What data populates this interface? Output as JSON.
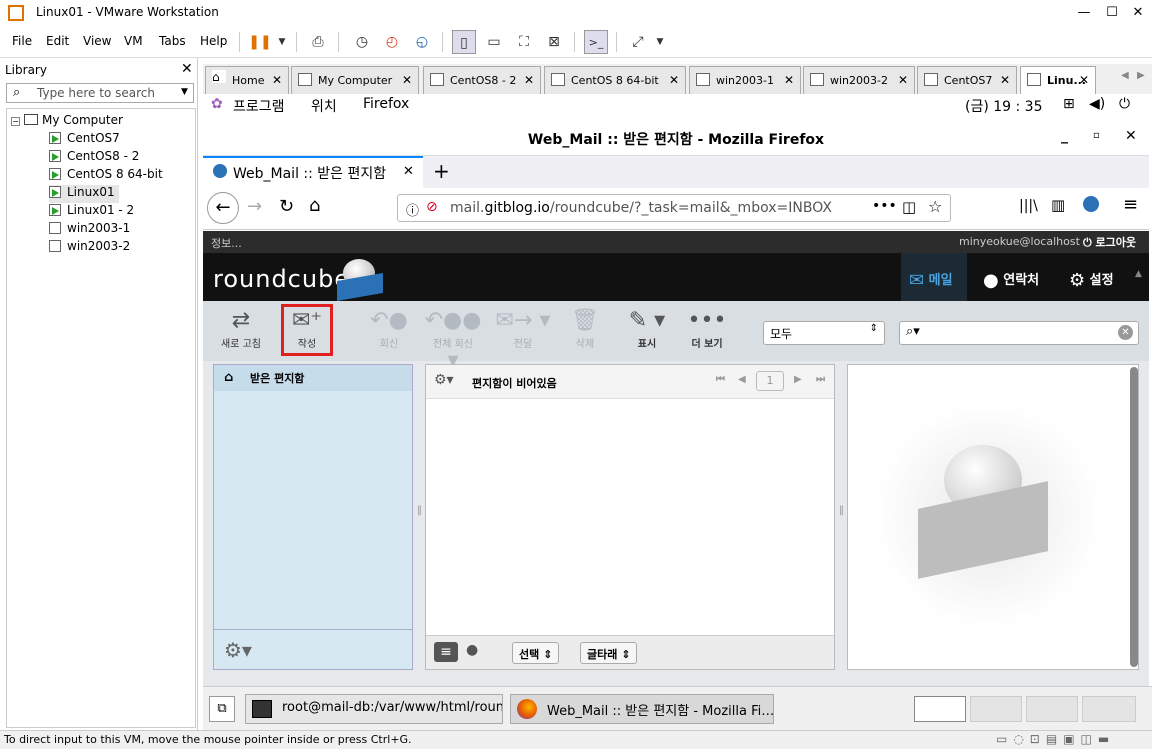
{
  "app": {
    "title": "Linux01 - VMware Workstation"
  },
  "menu": [
    "File",
    "Edit",
    "View",
    "VM",
    "Tabs",
    "Help"
  ],
  "library": {
    "header": "Library",
    "search_placeholder": "Type here to search",
    "root": "My Computer",
    "items": [
      "CentOS7",
      "CentOS8 - 2",
      "CentOS 8 64-bit",
      "Linux01",
      "Linux01 - 2",
      "win2003-1",
      "win2003-2"
    ]
  },
  "vm_tabs": [
    "Home",
    "My Computer",
    "CentOS8 - 2",
    "CentOS 8 64-bit",
    "win2003-1",
    "win2003-2",
    "CentOS7",
    "Linu..."
  ],
  "gnome": {
    "apps": "프로그램",
    "places": "위치",
    "firefox": "Firefox",
    "clock": "(금) 19 : 35"
  },
  "firefox": {
    "window_title": "Web_Mail :: 받은 편지함 - Mozilla Firefox",
    "tab_title": "Web_Mail :: 받은 편지함",
    "url_host": "mail.gitblog.io",
    "url_path": "/roundcube/?_task=mail&_mbox=INBOX",
    "url_prefix": "mail."
  },
  "roundcube": {
    "info": "정보...",
    "user": "minyeokue@localhost",
    "logout": "로그아웃",
    "logo": "roundcube",
    "nav": {
      "mail": "메일",
      "contacts": "연락처",
      "settings": "설정"
    },
    "toolbar": {
      "refresh": "새로 고침",
      "compose": "작성",
      "reply": "회신",
      "reply_all": "전체 회신",
      "forward": "전달",
      "delete": "삭제",
      "mark": "표시",
      "more": "더 보기"
    },
    "filter": "모두",
    "folder_inbox": "받은 편지함",
    "list_empty": "편지함이 비어있음",
    "page": "1",
    "select_btn": "선택",
    "thread_btn": "글타래"
  },
  "taskbar": {
    "terminal": "root@mail-db:/var/www/html/roun…",
    "firefox": "Web_Mail :: 받은 편지함 - Mozilla Fi…"
  },
  "status_text": "To direct input to this VM, move the mouse pointer inside or press Ctrl+G.",
  "colors": {
    "accent": "#0a84ff",
    "compose_highlight": "#e02020",
    "rc_header": "#111111",
    "folder_bg": "#d6e8f2"
  }
}
